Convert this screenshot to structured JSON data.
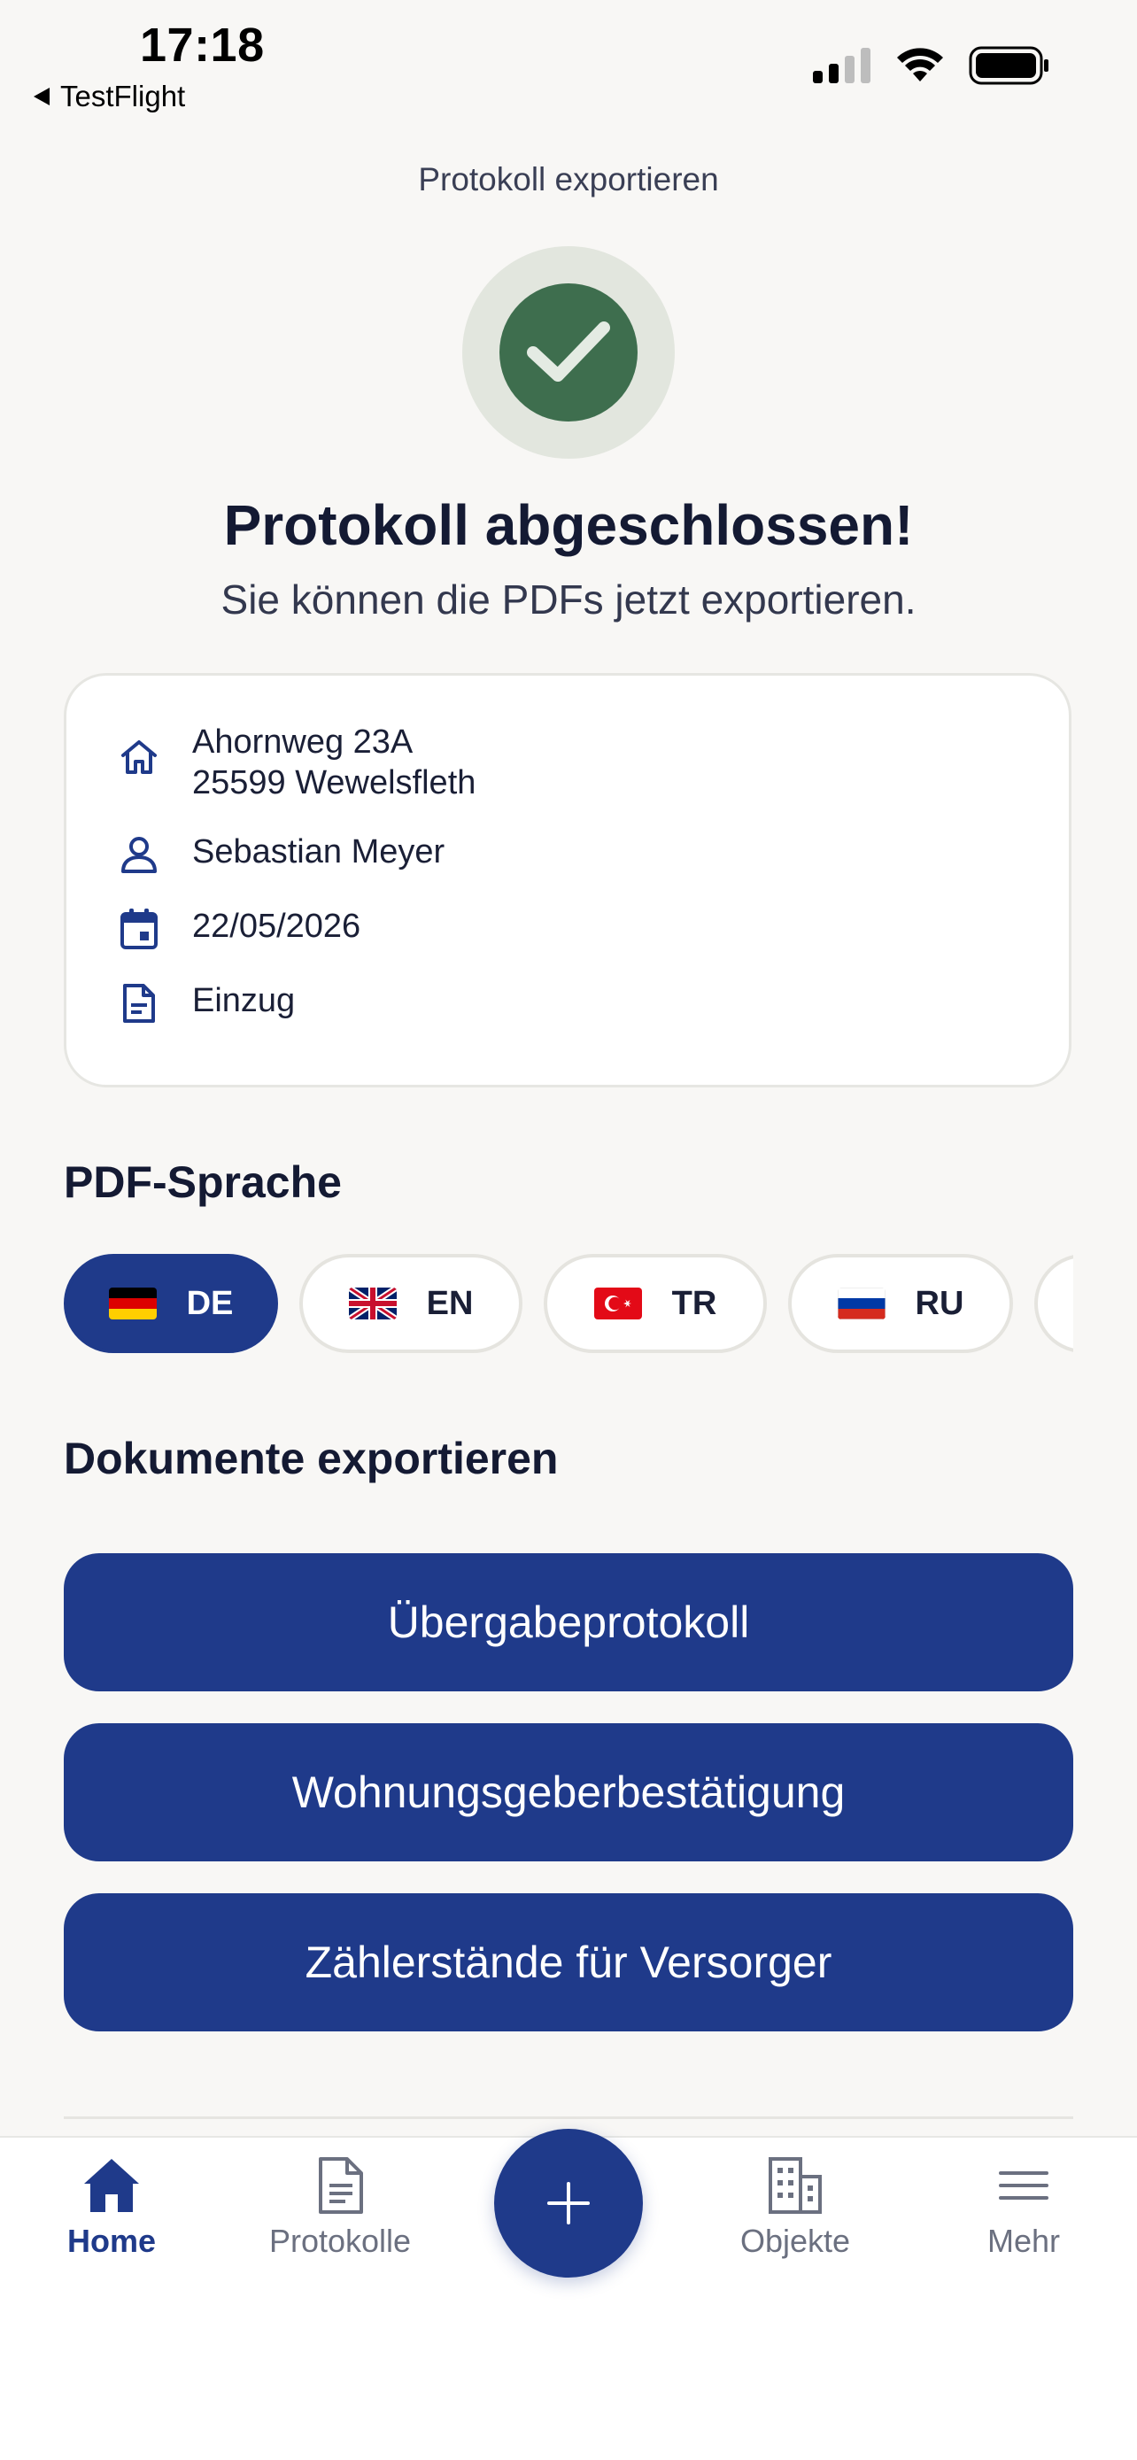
{
  "status_bar": {
    "time": "17:18",
    "back_app": "TestFlight"
  },
  "header": {
    "title": "Protokoll exportieren"
  },
  "success": {
    "headline": "Protokoll abgeschlossen!",
    "subline": "Sie können die PDFs jetzt exportieren."
  },
  "info": {
    "address_line1": "Ahornweg 23A",
    "address_line2": "25599 Wewelsfleth",
    "person": "Sebastian Meyer",
    "date": "22/05/2026",
    "type": "Einzug"
  },
  "pdf_language": {
    "heading": "PDF-Sprache",
    "options": [
      {
        "code": "DE",
        "flag": "germany-flag",
        "selected": true
      },
      {
        "code": "EN",
        "flag": "uk-flag",
        "selected": false
      },
      {
        "code": "TR",
        "flag": "turkey-flag",
        "selected": false
      },
      {
        "code": "RU",
        "flag": "russia-flag",
        "selected": false
      }
    ]
  },
  "export": {
    "heading": "Dokumente exportieren",
    "buttons": [
      "Übergabeprotokoll",
      "Wohnungsgeberbestätigung",
      "Zählerstände für Versorger"
    ]
  },
  "tabbar": {
    "items": [
      {
        "label": "Home",
        "icon": "home-icon",
        "active": true
      },
      {
        "label": "Protokolle",
        "icon": "document-icon",
        "active": false
      },
      {
        "label": "Objekte",
        "icon": "building-icon",
        "active": false
      },
      {
        "label": "Mehr",
        "icon": "menu-icon",
        "active": false
      }
    ],
    "fab_icon": "plus-icon"
  },
  "colors": {
    "primary": "#1f3a8a",
    "success": "#3e6e4e",
    "background": "#f8f7f5"
  }
}
